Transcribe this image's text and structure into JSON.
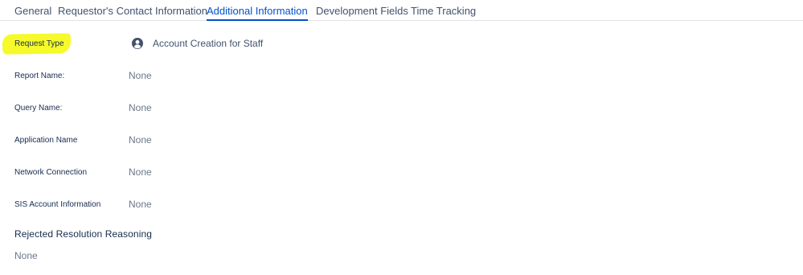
{
  "tabs": [
    {
      "label": "General",
      "active": false
    },
    {
      "label": "Requestor's Contact Information",
      "active": false
    },
    {
      "label": "Additional Information",
      "active": true
    },
    {
      "label": "Development Fields",
      "active": false
    },
    {
      "label": "Time Tracking",
      "active": false
    }
  ],
  "fields": {
    "request_type": {
      "label": "Request Type",
      "value": "Account Creation for Staff",
      "icon": "user-avatar-icon",
      "highlight_color": "#f6f92a"
    },
    "report_name": {
      "label": "Report Name:",
      "value": "None"
    },
    "query_name": {
      "label": "Query Name:",
      "value": "None"
    },
    "application_name": {
      "label": "Application Name",
      "value": "None"
    },
    "network_connection": {
      "label": "Network Connection",
      "value": "None"
    },
    "sis_account_information": {
      "label": "SIS Account Information",
      "value": "None"
    }
  },
  "rejected_resolution": {
    "heading": "Rejected Resolution Reasoning",
    "value": "None"
  },
  "colors": {
    "accent": "#0052cc",
    "text": "#172b4d",
    "muted": "#6b778c",
    "highlight": "#f6f92a"
  }
}
